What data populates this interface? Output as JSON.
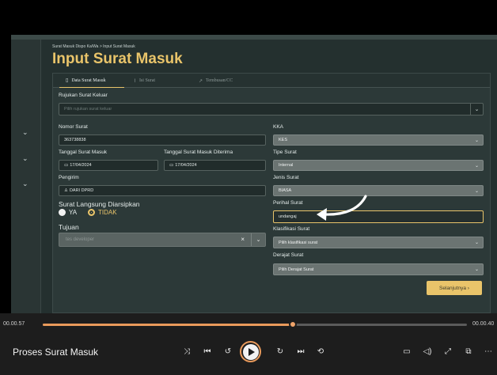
{
  "app": {
    "breadcrumb": "Surat Masuk Dispo Ka/Wa > Input Surat Masuk",
    "title": "Input Surat Masuk"
  },
  "tabs": [
    {
      "label": "Data Surat Masuk"
    },
    {
      "label": "Isi Surat"
    },
    {
      "label": "Tembusan/CC"
    }
  ],
  "form": {
    "rujukan_label": "Rujukan Surat Keluar",
    "rujukan_placeholder": "Pilih rujukan surat keluar",
    "nomor_label": "Nomor Surat",
    "nomor_value": "363738838",
    "tgl_masuk_label": "Tanggal Surat Masuk",
    "tgl_masuk_value": "17/04/2024",
    "tgl_diterima_label": "Tanggal Surat Masuk Diterima",
    "tgl_diterima_value": "17/04/2024",
    "pengirim_label": "Pengirim",
    "pengirim_value": "DARI DPRD",
    "langsung_label": "Surat Langsung Diarsipkan",
    "opt_ya": "YA",
    "opt_tidak": "TIDAK",
    "tujuan_label": "Tujuan",
    "tujuan_placeholder": "tes developer",
    "kka_label": "KKA",
    "kka_value": "KES",
    "tipe_label": "Tipe Surat",
    "tipe_value": "Internal",
    "jenis_label": "Jenis Surat",
    "jenis_value": "BIASA",
    "perihal_label": "Perihal Surat",
    "perihal_value": "undangaj",
    "klasifikasi_label": "Klasifikasi Surat",
    "klasifikasi_placeholder": "Pilih klasifikasi surat",
    "derajat_label": "Derajat Surat",
    "derajat_placeholder": "Pilih Derajat Surat",
    "next_label": "Selanjutnya ›"
  },
  "player": {
    "time_current": "00.00.57",
    "time_end": "00.00.40",
    "title": "Proses Surat Masuk",
    "progress": 0.59
  },
  "colors": {
    "accent": "#e9c46a",
    "seek": "#e99a5b",
    "app_bg": "#24302f"
  }
}
